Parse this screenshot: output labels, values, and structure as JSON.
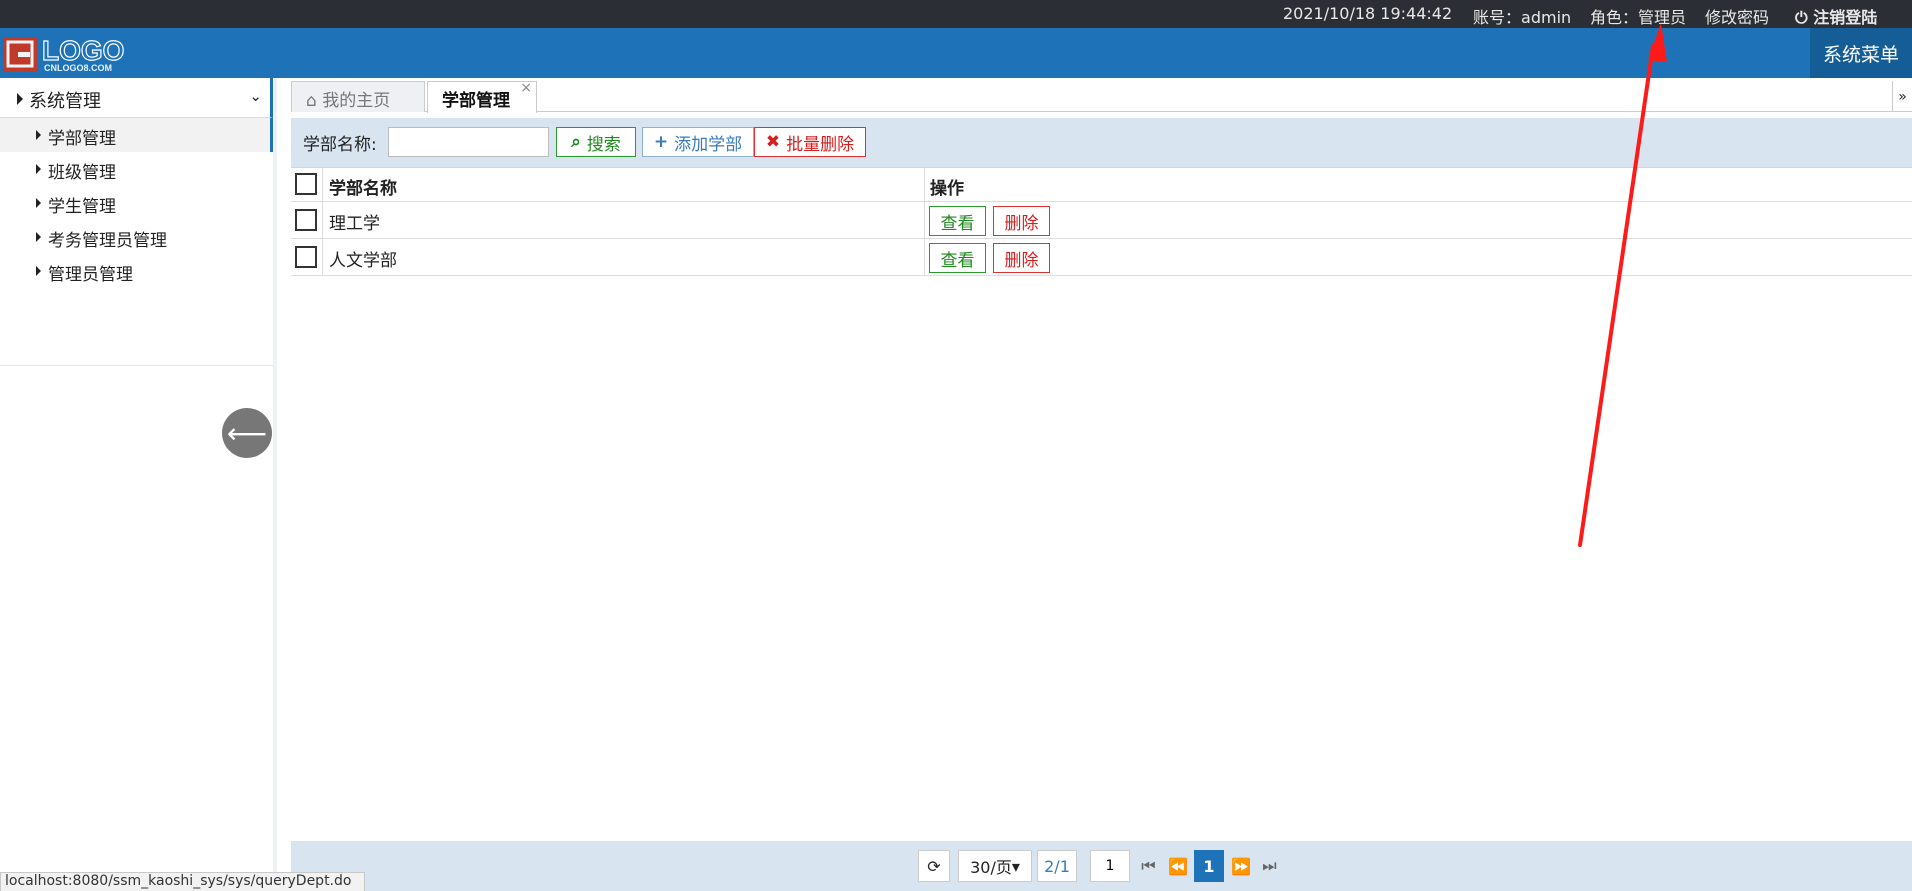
{
  "topbar": {
    "datetime": "2021/10/18 19:44:42",
    "account_label": "账号：",
    "account_value": "admin",
    "role_label": "角色：",
    "role_value": "管理员",
    "change_password": "修改密码",
    "logout": "注销登陆"
  },
  "header": {
    "logo_text": "LOGO",
    "logo_subtext": "CNLOGO8.COM",
    "system_menu": "系统菜单"
  },
  "sidebar": {
    "group": {
      "label": "系统管理",
      "icon": "chevron-down-icon"
    },
    "items": [
      {
        "label": "学部管理",
        "active": true
      },
      {
        "label": "班级管理",
        "active": false
      },
      {
        "label": "学生管理",
        "active": false
      },
      {
        "label": "考务管理员管理",
        "active": false
      },
      {
        "label": "管理员管理",
        "active": false
      }
    ],
    "toggle_icon": "arrow-left-icon"
  },
  "tabs": [
    {
      "label": "我的主页",
      "icon": "home-icon",
      "closable": false
    },
    {
      "label": "学部管理",
      "closable": true,
      "close_glyph": "×"
    }
  ],
  "tab_scroll_glyph": "»",
  "toolbar": {
    "search_label": "学部名称:",
    "search_value": "",
    "search_button": "搜索",
    "add_button": "添加学部",
    "batch_delete_button": "批量删除"
  },
  "table": {
    "columns": [
      "学部名称",
      "操作"
    ],
    "rows": [
      {
        "name": "理工学",
        "view": "查看",
        "delete": "删除"
      },
      {
        "name": "人文学部",
        "view": "查看",
        "delete": "删除"
      }
    ]
  },
  "pagination": {
    "page_size": "30/页",
    "page_info": "2/1",
    "page_input": "1",
    "current_page": "1"
  },
  "status_bar_url": "localhost:8080/ssm_kaoshi_sys/sys/queryDept.do",
  "colors": {
    "topbar": "#2b2f35",
    "header": "#1e73b8",
    "accent": "#1e73b8",
    "success": "#1f8a1f",
    "danger": "#d81e1e",
    "annotation_arrow": "#ff1a1a"
  }
}
